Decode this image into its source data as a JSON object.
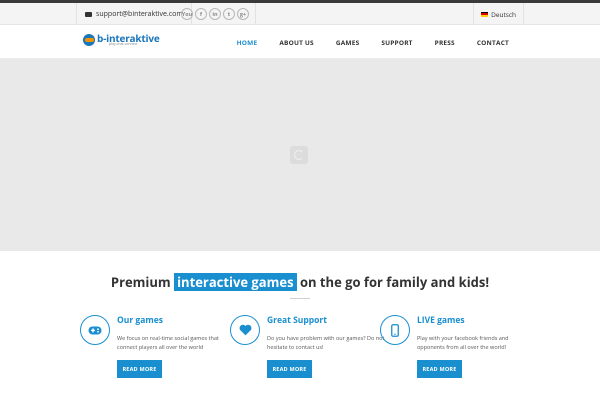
{
  "topbar": {
    "email": "support@binteraktive.com",
    "social": [
      {
        "icon": "youtube-icon",
        "glyph": "You"
      },
      {
        "icon": "facebook-icon",
        "glyph": "f"
      },
      {
        "icon": "linkedin-icon",
        "glyph": "in"
      },
      {
        "icon": "twitter-icon",
        "glyph": "t"
      },
      {
        "icon": "googleplus-icon",
        "glyph": "g+"
      }
    ],
    "language": "Deutsch"
  },
  "header": {
    "logo_name": "b-interaktive",
    "logo_tagline": "play.chat.connect",
    "nav": [
      {
        "label": "HOME",
        "active": true
      },
      {
        "label": "ABOUT US",
        "active": false
      },
      {
        "label": "GAMES",
        "active": false
      },
      {
        "label": "SUPPORT",
        "active": false
      },
      {
        "label": "PRESS",
        "active": false
      },
      {
        "label": "CONTACT",
        "active": false
      }
    ]
  },
  "headline": {
    "pre": "Premium",
    "highlight": "interactive games",
    "post": "on the go for family and kids!"
  },
  "features": [
    {
      "icon": "gamepad-icon",
      "title": "Our games",
      "description": "We focus on real-time social games that connect players all over the world",
      "button": "READ MORE"
    },
    {
      "icon": "heart-icon",
      "title": "Great Support",
      "description": "Do you have problem with our games? Do not hesitate to contact us!",
      "button": "READ MORE"
    },
    {
      "icon": "mobile-icon",
      "title": "LIVE games",
      "description": "Play with your facebook friends and opponents from all over the world!",
      "button": "READ MORE"
    }
  ],
  "colors": {
    "accent": "#1a8fd0",
    "logo_blue": "#1a75bb",
    "logo_orange": "#f39200",
    "hero_bg": "#e9e9e9"
  }
}
